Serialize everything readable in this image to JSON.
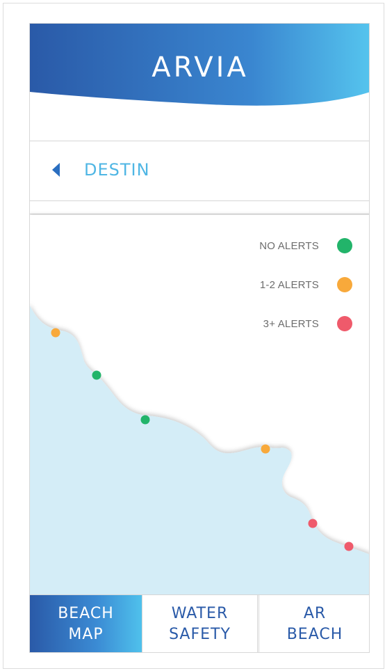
{
  "header": {
    "title": "ARVIA"
  },
  "location": {
    "label": "DESTIN"
  },
  "legend": [
    {
      "label": "NO ALERTS",
      "color": "#22b46a"
    },
    {
      "label": "1-2 ALERTS",
      "color": "#f8a93b"
    },
    {
      "label": "3+ ALERTS",
      "color": "#ef5a6b"
    }
  ],
  "map": {
    "water_color": "#d4edf7",
    "markers": [
      {
        "status": "1-2 ALERTS",
        "color": "#f8a93b"
      },
      {
        "status": "NO ALERTS",
        "color": "#22b46a"
      },
      {
        "status": "NO ALERTS",
        "color": "#22b46a"
      },
      {
        "status": "1-2 ALERTS",
        "color": "#f8a93b"
      },
      {
        "status": "3+ ALERTS",
        "color": "#ef5a6b"
      },
      {
        "status": "3+ ALERTS",
        "color": "#ef5a6b"
      }
    ]
  },
  "tabs": [
    {
      "label": "BEACH\nMAP",
      "active": true
    },
    {
      "label": "WATER\nSAFETY",
      "active": false
    },
    {
      "label": "AR\nBEACH",
      "active": false
    }
  ],
  "colors": {
    "brand_dark": "#2a5aa8",
    "brand_light": "#4fc1ec"
  }
}
